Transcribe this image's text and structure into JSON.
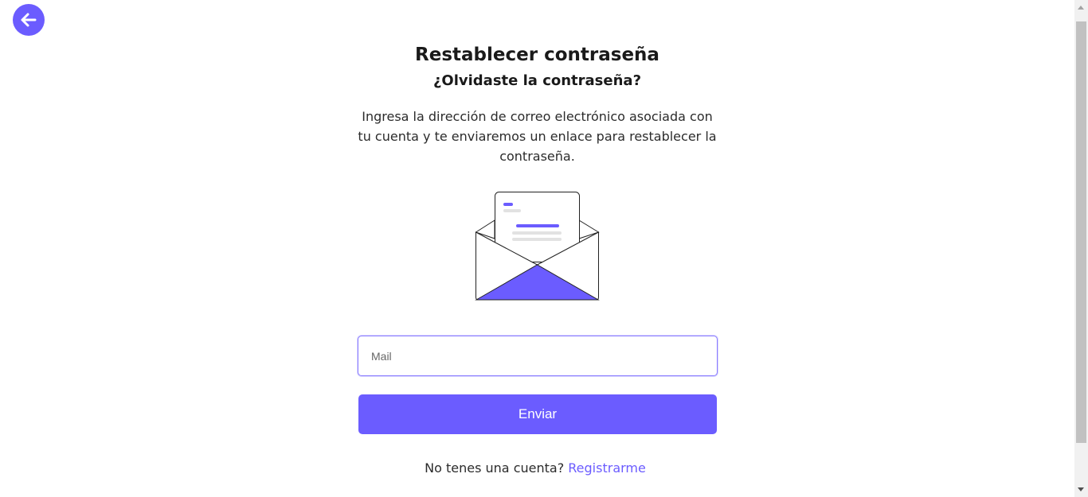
{
  "header": {
    "back_icon": "arrow-left-icon"
  },
  "main": {
    "title": "Restablecer contraseña",
    "subtitle": "¿Olvidaste la contraseña?",
    "description": "Ingresa la dirección de correo electrónico asociada con tu cuenta y te enviaremos un enlace para restablecer la contraseña.",
    "illustration_icon": "open-envelope-icon"
  },
  "form": {
    "mail_placeholder": "Mail",
    "mail_value": "",
    "submit_label": "Enviar"
  },
  "footer": {
    "question": "No tenes una cuenta?",
    "register_link": "Registrarme"
  },
  "colors": {
    "accent": "#6b5cff",
    "text": "#1a1a1a",
    "background": "#ffffff"
  }
}
